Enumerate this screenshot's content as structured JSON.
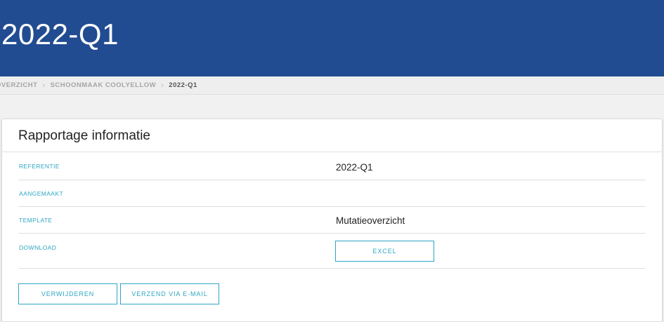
{
  "header": {
    "title": "2022-Q1"
  },
  "breadcrumb": {
    "items": [
      "OVERZICHT",
      "SCHOONMAAK COOLYELLOW",
      "2022-Q1"
    ],
    "separator": "›"
  },
  "card": {
    "title": "Rapportage informatie",
    "rows": [
      {
        "label": "REFERENTIE",
        "value": "2022-Q1"
      },
      {
        "label": "AANGEMAAKT",
        "value": ""
      },
      {
        "label": "TEMPLATE",
        "value": "Mutatieoverzicht"
      },
      {
        "label": "DOWNLOAD",
        "button": "EXCEL"
      }
    ]
  },
  "actions": {
    "delete_label": "VERWIJDEREN",
    "email_label": "VERZEND VIA E-MAIL"
  },
  "colors": {
    "header_bg": "#224c91",
    "accent": "#2ea6c4",
    "page_bg": "#f1f1f1"
  }
}
